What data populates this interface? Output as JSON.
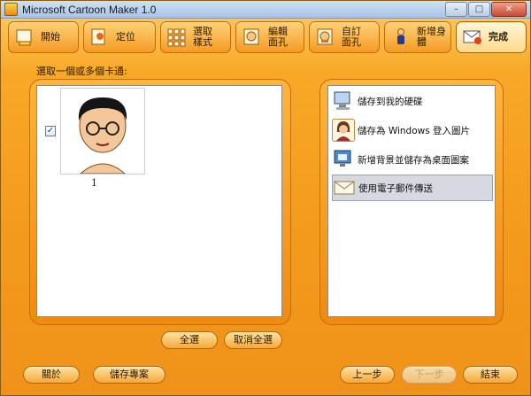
{
  "window": {
    "title": "Microsoft Cartoon Maker 1.0"
  },
  "window_controls": {
    "minimize": "–",
    "maximize": "□",
    "close": "✕"
  },
  "toolbar": {
    "items": [
      {
        "label": "開始",
        "icon": "home-icon"
      },
      {
        "label": "定位",
        "icon": "position-icon"
      },
      {
        "label": "選取\n樣式",
        "icon": "style-grid-icon"
      },
      {
        "label": "編輯\n面孔",
        "icon": "edit-face-icon"
      },
      {
        "label": "自訂\n面孔",
        "icon": "custom-face-icon"
      },
      {
        "label": "新增身體",
        "icon": "body-icon"
      },
      {
        "label": "完成",
        "icon": "finish-icon",
        "active": true
      }
    ]
  },
  "main": {
    "prompt": "選取一個或多個卡通:",
    "thumbnail": {
      "label": "1",
      "checked": true,
      "check_glyph": "✓"
    }
  },
  "options": [
    {
      "label": "儲存到我的硬碟",
      "icon": "computer-icon"
    },
    {
      "label": "儲存為 Windows 登入圖片",
      "icon": "avatar-icon"
    },
    {
      "label": "新增背景並儲存為桌面圖案",
      "icon": "desktop-image-icon"
    },
    {
      "label": "使用電子郵件傳送",
      "icon": "email-icon",
      "selected": true
    }
  ],
  "selection": {
    "select_all": "全選",
    "deselect_all": "取消全選"
  },
  "footer": {
    "about": "關於",
    "save_project": "儲存專案",
    "back": "上一步",
    "next": "下一步",
    "finish": "結束"
  },
  "colors": {
    "accent": "#f49a22",
    "panel_white": "#ffffff",
    "selected_row": "#d6d9e2"
  }
}
